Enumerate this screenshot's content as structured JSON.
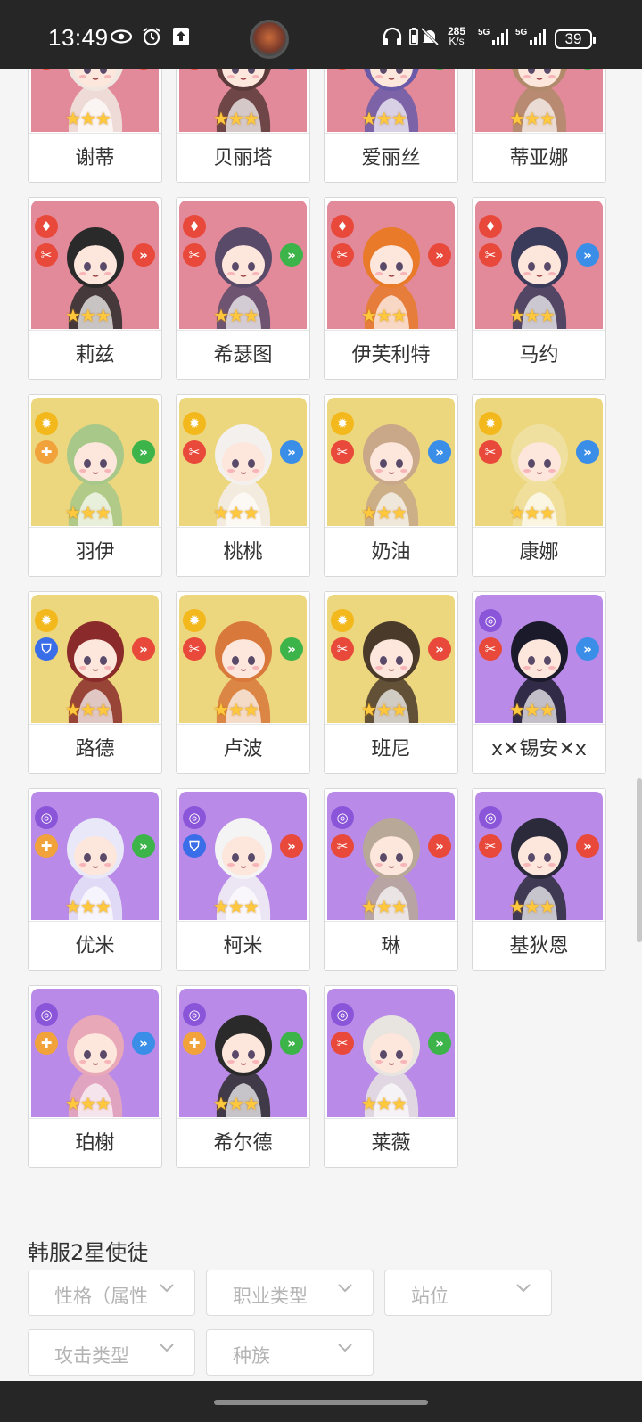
{
  "status_bar": {
    "time": "13:49",
    "net_speed_top": "285",
    "net_speed_bottom": "K/s",
    "battery": "39"
  },
  "characters": [
    {
      "name": "谢蒂",
      "color": "red",
      "attr": "fire",
      "cls": "slash",
      "pos": "front-red"
    },
    {
      "name": "贝丽塔",
      "color": "red",
      "attr": "fire",
      "cls": "slash",
      "pos": "back-blue"
    },
    {
      "name": "爱丽丝",
      "color": "red",
      "attr": "fire",
      "cls": "slash",
      "pos": "mid-green"
    },
    {
      "name": "蒂亚娜",
      "color": "red",
      "attr": "fire",
      "cls": "heal",
      "pos": "mid-green"
    },
    {
      "name": "莉兹",
      "color": "red",
      "attr": "fire",
      "cls": "slash",
      "pos": "front-red"
    },
    {
      "name": "希瑟图",
      "color": "red",
      "attr": "fire",
      "cls": "slash",
      "pos": "mid-green"
    },
    {
      "name": "伊芙利特",
      "color": "red",
      "attr": "fire",
      "cls": "slash",
      "pos": "front-red"
    },
    {
      "name": "马约",
      "color": "red",
      "attr": "fire",
      "cls": "slash",
      "pos": "back-blue"
    },
    {
      "name": "羽伊",
      "color": "yellow",
      "attr": "light",
      "cls": "heal",
      "pos": "mid-green"
    },
    {
      "name": "桃桃",
      "color": "yellow",
      "attr": "light",
      "cls": "slash",
      "pos": "back-blue"
    },
    {
      "name": "奶油",
      "color": "yellow",
      "attr": "light",
      "cls": "slash",
      "pos": "back-blue"
    },
    {
      "name": "康娜",
      "color": "yellow",
      "attr": "light",
      "cls": "slash",
      "pos": "back-blue"
    },
    {
      "name": "路德",
      "color": "yellow",
      "attr": "light",
      "cls": "shield",
      "pos": "front-red"
    },
    {
      "name": "卢波",
      "color": "yellow",
      "attr": "light",
      "cls": "slash",
      "pos": "mid-green"
    },
    {
      "name": "班尼",
      "color": "yellow",
      "attr": "light",
      "cls": "slash",
      "pos": "front-red"
    },
    {
      "name": "ⅹ✕锡安✕ⅹ",
      "color": "purple",
      "attr": "dark",
      "cls": "slash",
      "pos": "back-blue"
    },
    {
      "name": "优米",
      "color": "purple",
      "attr": "dark",
      "cls": "heal",
      "pos": "mid-green"
    },
    {
      "name": "柯米",
      "color": "purple",
      "attr": "dark",
      "cls": "shield",
      "pos": "front-red"
    },
    {
      "name": "琳",
      "color": "purple",
      "attr": "dark",
      "cls": "slash",
      "pos": "front-red"
    },
    {
      "name": "基狄恩",
      "color": "purple",
      "attr": "dark",
      "cls": "slash",
      "pos": "front-red"
    },
    {
      "name": "珀榭",
      "color": "purple",
      "attr": "dark",
      "cls": "heal",
      "pos": "back-blue"
    },
    {
      "name": "希尔德",
      "color": "purple",
      "attr": "dark",
      "cls": "heal",
      "pos": "mid-green"
    },
    {
      "name": "莱薇",
      "color": "purple",
      "attr": "dark",
      "cls": "slash",
      "pos": "mid-green"
    }
  ],
  "section_title": "韩服2星使徒",
  "filters": [
    {
      "label": "性格（属性"
    },
    {
      "label": "职业类型"
    },
    {
      "label": "站位"
    },
    {
      "label": "攻击类型"
    },
    {
      "label": "种族"
    }
  ],
  "colors": {
    "red_bg": "#e28a9a",
    "yellow_bg": "#ecd67e",
    "purple_bg": "#b98ae8",
    "fire": "#e8493a",
    "light": "#f2b81c",
    "dark": "#8a55d8",
    "slash": "#e8493a",
    "heal": "#f2a23a",
    "shield": "#3a6ee8",
    "front": "#e8493a",
    "back": "#3a8ee8",
    "mid": "#3cb44a"
  },
  "star_glyphs": "★★★"
}
